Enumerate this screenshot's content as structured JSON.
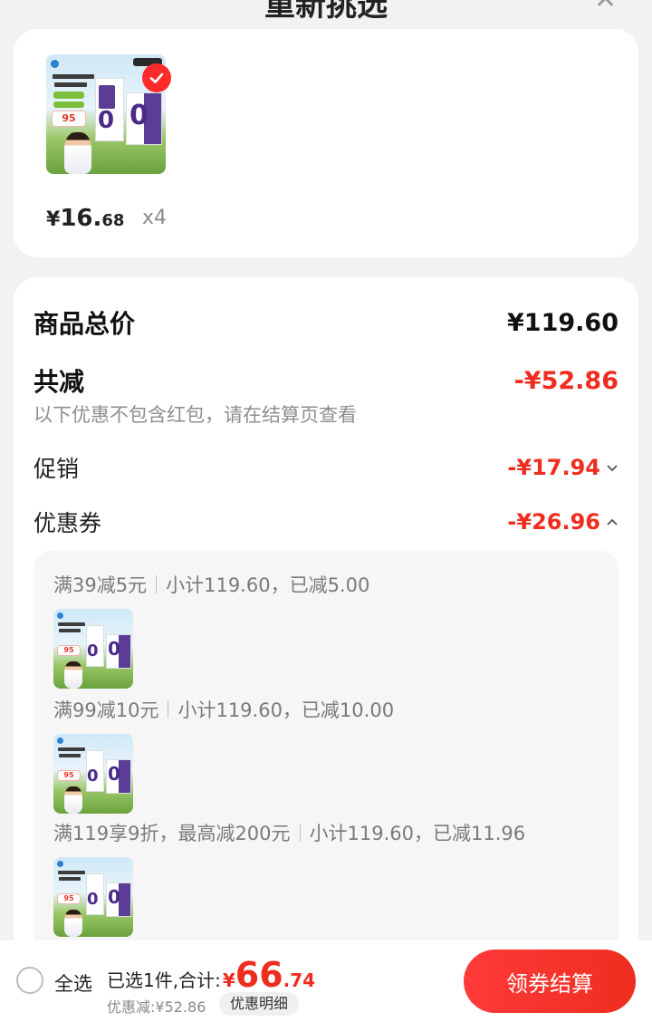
{
  "header": {
    "title": "重新挑选"
  },
  "product": {
    "price_symbol": "¥",
    "price_int": "16.",
    "price_dec": "68",
    "quantity": "x4",
    "thumbnail_icon": "milk-product-image"
  },
  "summary": {
    "total_label": "商品总价",
    "total_value": "¥119.60",
    "discount_label": "共减",
    "discount_value": "-¥52.86",
    "hint": "以下优惠不包含红包，请在结算页查看",
    "promo_label": "促销",
    "promo_value": "-¥17.94",
    "coupon_label": "优惠券",
    "coupon_value": "-¥26.96"
  },
  "coupons": [
    {
      "rule": "满39减5元",
      "detail": "小计119.60，已减5.00"
    },
    {
      "rule": "满99减10元",
      "detail": "小计119.60，已减10.00"
    },
    {
      "rule": "满119享9折，最高减200元",
      "detail": "小计119.60，已减11.96"
    }
  ],
  "footer": {
    "select_all": "全选",
    "selected_total_label": "已选1件,合计:",
    "total_symbol": "¥",
    "total_int": "66",
    "total_dec": ".74",
    "discount_text": "优惠减:¥52.86",
    "detail_button": "优惠明细",
    "checkout_button": "领券结算"
  },
  "colors": {
    "accent": "#ee2d1f",
    "background": "#f2f2f2"
  }
}
